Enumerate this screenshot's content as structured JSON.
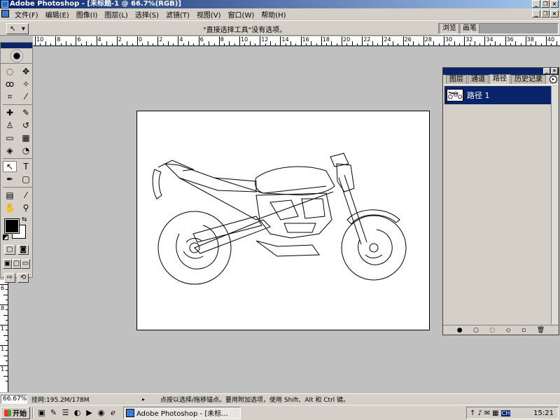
{
  "window": {
    "title": "Adobe Photoshop - [未标题-1 @ 66.7%(RGB)]",
    "controls": {
      "minimize": "_",
      "restore": "❐",
      "close": "×"
    }
  },
  "menu": [
    "文件(F)",
    "编辑(E)",
    "图像(I)",
    "图层(L)",
    "选择(S)",
    "滤镜(T)",
    "视图(V)",
    "窗口(W)",
    "帮助(H)"
  ],
  "options_bar": {
    "tool_glyph": "↖",
    "dropdown_glyph": "▾",
    "message": "\"直接选择工具\"没有选项。",
    "palette_well_tabs": [
      "浏览",
      "画笔"
    ]
  },
  "ruler_h_labels": [
    "10",
    "8",
    "6",
    "4",
    "2",
    "0",
    "2",
    "4",
    "6",
    "8",
    "10",
    "12",
    "14",
    "16",
    "18",
    "20",
    "22",
    "24",
    "26",
    "28",
    "30",
    "32",
    "34",
    "36",
    "38",
    "40"
  ],
  "ruler_v_labels": [
    "6",
    "8",
    "1",
    "1",
    "1"
  ],
  "toolbox": {
    "tools": [
      {
        "name": "marquee-tool-icon",
        "glyph": "◌"
      },
      {
        "name": "move-tool-icon",
        "glyph": "✥"
      },
      {
        "name": "lasso-tool-icon",
        "glyph": "ꝏ"
      },
      {
        "name": "magic-wand-tool-icon",
        "glyph": "✧"
      },
      {
        "name": "crop-tool-icon",
        "glyph": "⌗"
      },
      {
        "name": "slice-tool-icon",
        "glyph": "⁄"
      },
      {
        "name": "healing-brush-tool-icon",
        "glyph": "✚"
      },
      {
        "name": "brush-tool-icon",
        "glyph": "✎"
      },
      {
        "name": "clone-stamp-tool-icon",
        "glyph": "♙"
      },
      {
        "name": "history-brush-tool-icon",
        "glyph": "↺"
      },
      {
        "name": "eraser-tool-icon",
        "glyph": "▭"
      },
      {
        "name": "gradient-tool-icon",
        "glyph": "▦"
      },
      {
        "name": "blur-tool-icon",
        "glyph": "◈"
      },
      {
        "name": "dodge-tool-icon",
        "glyph": "◔"
      },
      {
        "name": "direct-selection-tool-icon",
        "glyph": "↖"
      },
      {
        "name": "type-tool-icon",
        "glyph": "T"
      },
      {
        "name": "pen-tool-icon",
        "glyph": "✒"
      },
      {
        "name": "rectangle-tool-icon",
        "glyph": "▢"
      },
      {
        "name": "notes-tool-icon",
        "glyph": "▤"
      },
      {
        "name": "eyedropper-tool-icon",
        "glyph": "⁄"
      },
      {
        "name": "hand-tool-icon",
        "glyph": "✋"
      },
      {
        "name": "zoom-tool-icon",
        "glyph": "⚲"
      }
    ],
    "active_tool_index": 14,
    "foreground_color": "#000000",
    "background_color": "#ffffff",
    "swap_glyph": "⇆",
    "mode_buttons": [
      "▢",
      "◙"
    ],
    "screen_buttons": [
      "▣",
      "▢",
      "▭"
    ],
    "jump_buttons": [
      "⇨",
      "⟲"
    ]
  },
  "paths_palette": {
    "tabs": [
      "图层",
      "通道",
      "路径",
      "历史记录"
    ],
    "active_tab_index": 2,
    "menu_glyph": "▸",
    "items": [
      {
        "name": "路径 1",
        "selected": true
      }
    ],
    "footer_buttons": [
      "●",
      "○",
      "◌",
      "◇",
      "▫",
      "🗑"
    ]
  },
  "status": {
    "zoom": "66.67%",
    "doc_size": "挂网:195.2M/178M",
    "arrow": "▸",
    "hint": "点按以选择/拖移锚点。要用附加选项，使用 Shift、Alt 和 Ctrl 键。"
  },
  "taskbar": {
    "start_label": "开始",
    "quick_launch": [
      "▣",
      "✎",
      "☰",
      "◐",
      "▶",
      "◉",
      "ℯ"
    ],
    "task_label": "Adobe Photoshop - [未标...",
    "tray": [
      "↑",
      "♪",
      "✉",
      "▦"
    ],
    "ime": "CH",
    "clock": "15:21"
  },
  "colors": {
    "title_gradient_start": "#0a246a",
    "title_gradient_end": "#a6caf0",
    "chrome": "#d4d0c8",
    "workspace": "#c0c0c0",
    "selection": "#0a246a"
  }
}
